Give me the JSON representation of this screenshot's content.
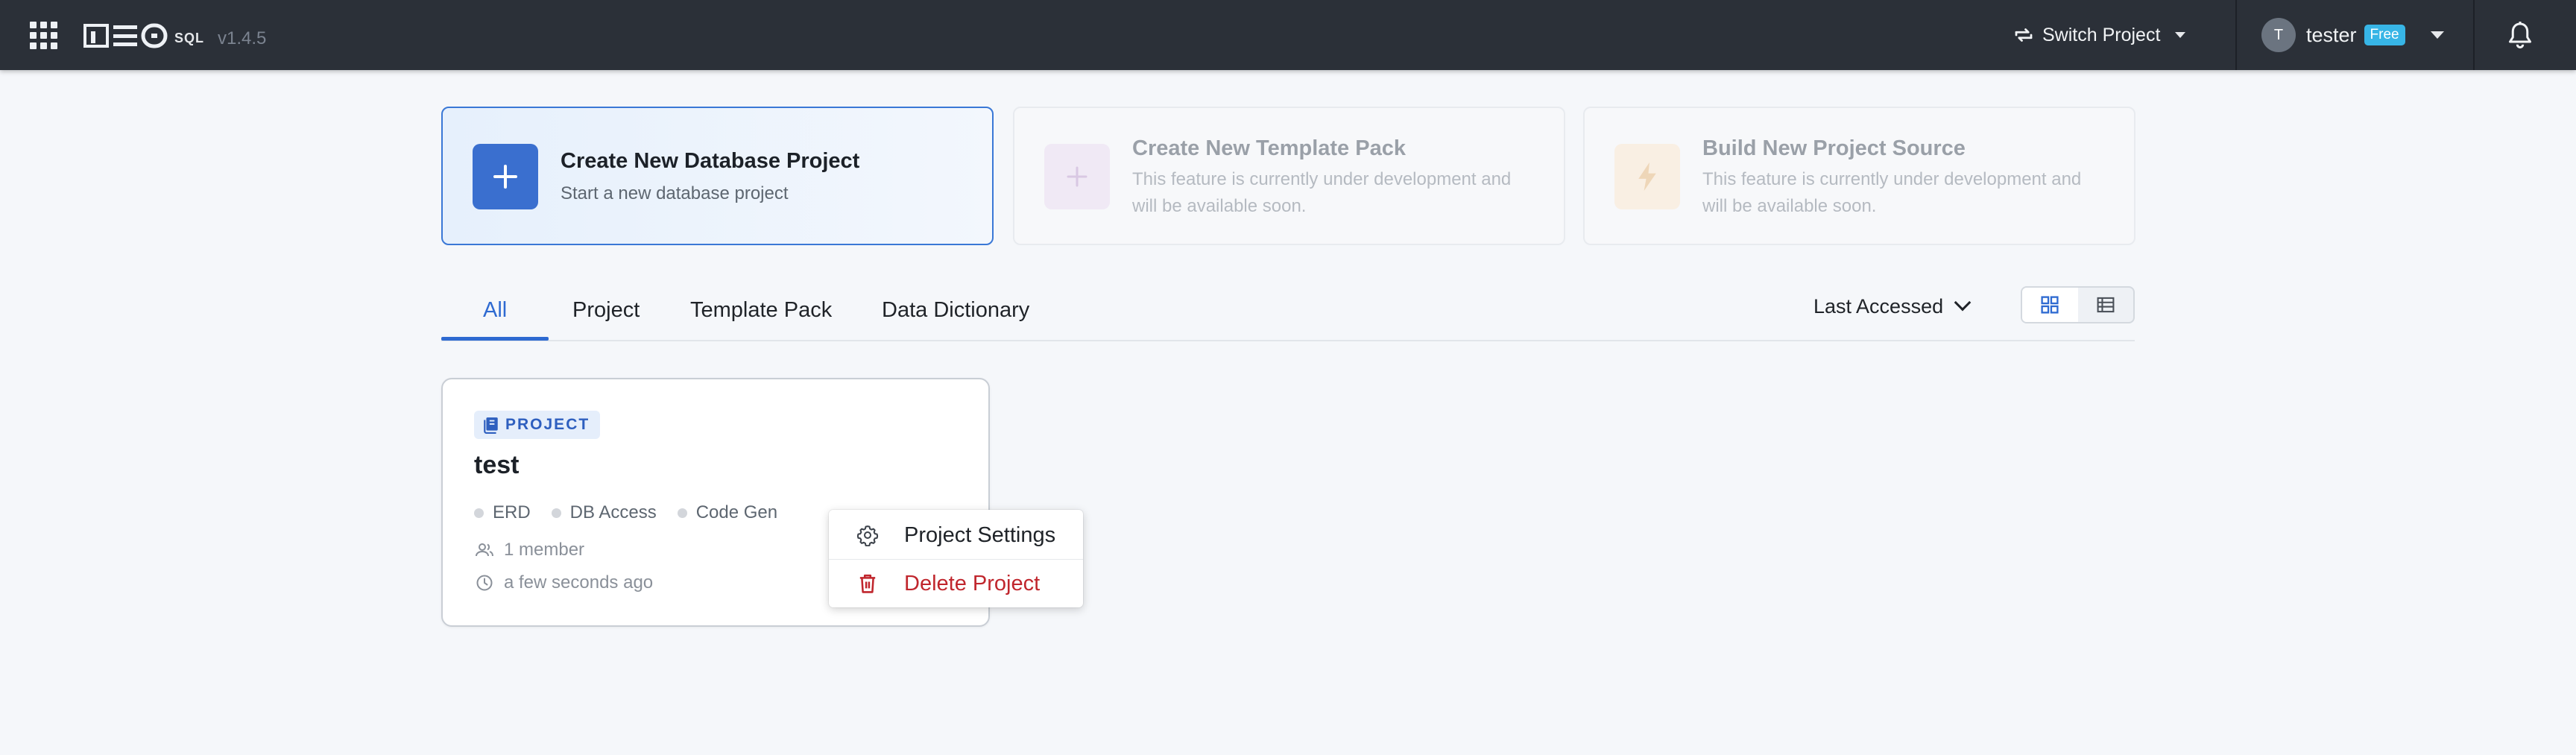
{
  "app": {
    "version": "v1.4.5",
    "logo_text": "NEO",
    "logo_suffix": "SQL"
  },
  "header": {
    "switch_project_label": "Switch Project",
    "user": {
      "initial": "T",
      "name": "tester",
      "plan_badge": "Free"
    }
  },
  "actions": [
    {
      "title": "Create New Database Project",
      "subtitle": "Start a new database project",
      "icon": "plus-icon",
      "enabled": true
    },
    {
      "title": "Create New Template Pack",
      "subtitle": "This feature is currently under development and will be available soon.",
      "icon": "plus-icon",
      "enabled": false
    },
    {
      "title": "Build New Project Source",
      "subtitle": "This feature is currently under development and will be available soon.",
      "icon": "lightning-icon",
      "enabled": false
    }
  ],
  "tabs": [
    {
      "label": "All",
      "active": true
    },
    {
      "label": "Project",
      "active": false
    },
    {
      "label": "Template Pack",
      "active": false
    },
    {
      "label": "Data Dictionary",
      "active": false
    }
  ],
  "sort": {
    "selected": "Last Accessed"
  },
  "view_mode": "grid",
  "projects": [
    {
      "type_badge": "PROJECT",
      "name": "test",
      "features": [
        "ERD",
        "DB Access",
        "Code Gen"
      ],
      "members": "1 member",
      "last_accessed": "a few seconds ago"
    }
  ],
  "context_menu": {
    "items": [
      {
        "label": "Project Settings",
        "icon": "gear-icon"
      },
      {
        "label": "Delete Project",
        "icon": "trash-icon"
      }
    ]
  },
  "colors": {
    "topbar": "#2b3038",
    "accent": "#2e6ad1",
    "danger": "#c0262d",
    "badge_free": "#37b5e6"
  }
}
